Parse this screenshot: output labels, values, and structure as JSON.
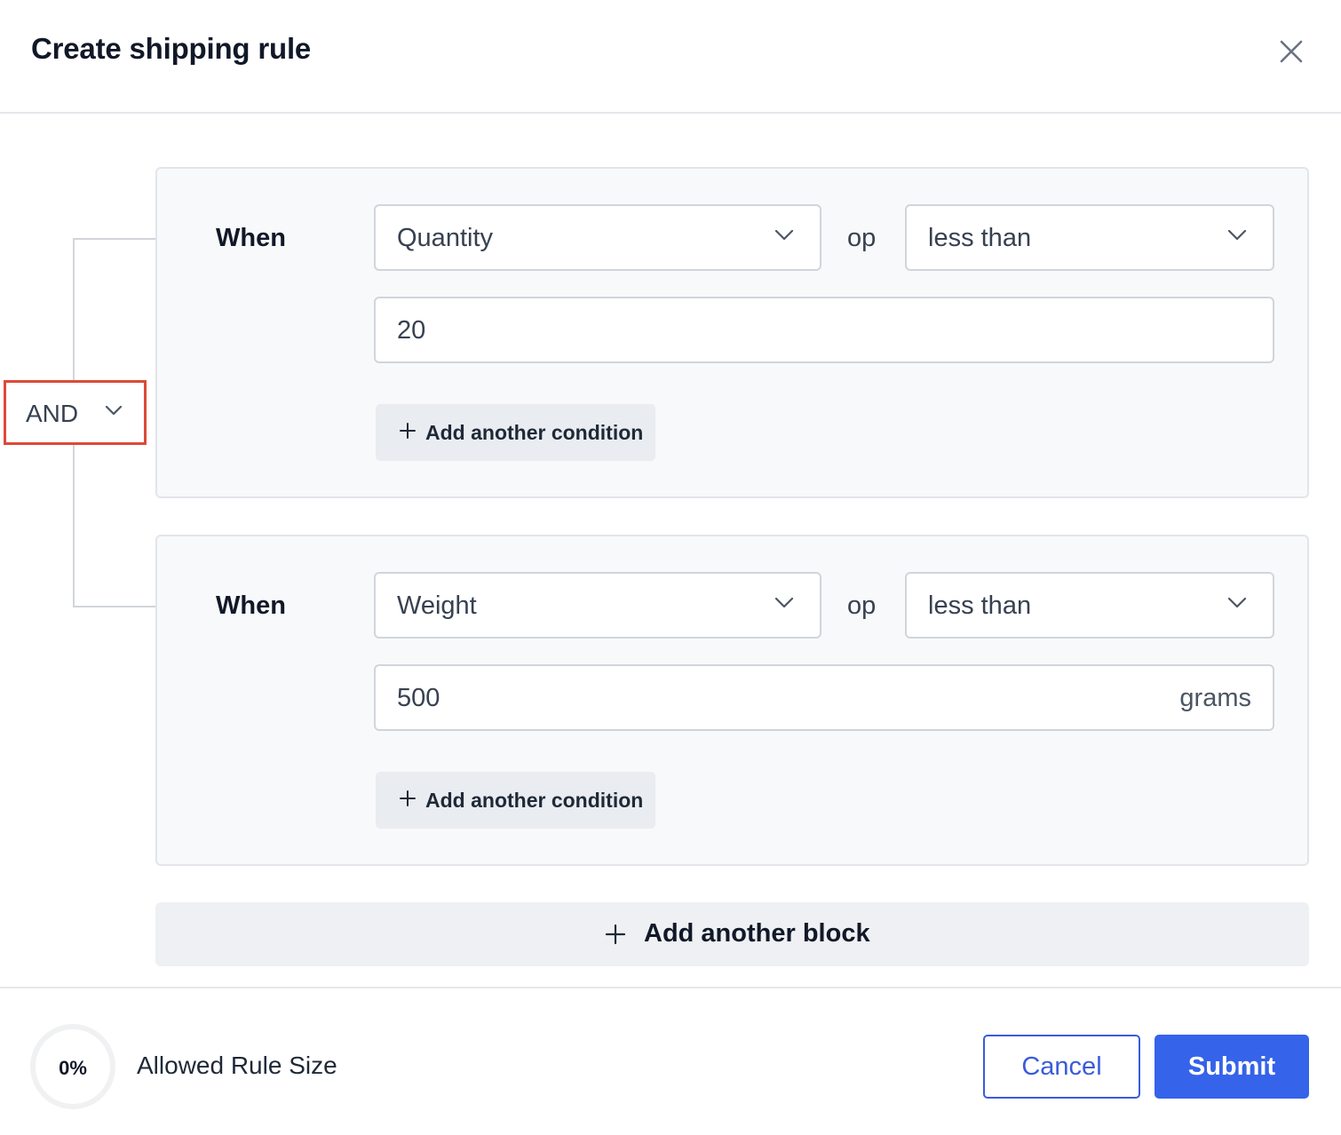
{
  "dialog": {
    "title": "Create shipping rule",
    "close_icon": "close-icon"
  },
  "logic_operator": {
    "value": "AND"
  },
  "blocks": [
    {
      "when_label": "When",
      "field": "Quantity",
      "op_label": "op",
      "comparator": "less than",
      "value": "20",
      "unit": "",
      "add_condition_label": "Add another condition"
    },
    {
      "when_label": "When",
      "field": "Weight",
      "op_label": "op",
      "comparator": "less than",
      "value": "500",
      "unit": "grams",
      "add_condition_label": "Add another condition"
    }
  ],
  "add_block_label": "Add another block",
  "footer": {
    "rule_size_percent": "0%",
    "rule_size_label": "Allowed Rule Size",
    "cancel_label": "Cancel",
    "submit_label": "Submit"
  },
  "colors": {
    "primary": "#3563e9",
    "highlight_border": "#dc4a38"
  }
}
